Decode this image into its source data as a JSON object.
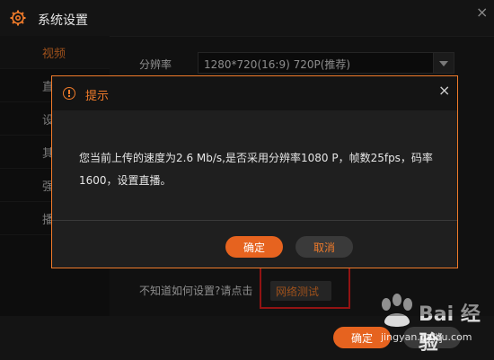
{
  "window": {
    "title": "系统设置"
  },
  "sidebar": {
    "items": [
      {
        "label": "视频",
        "active": true
      },
      {
        "label": "直",
        "active": false
      },
      {
        "label": "设",
        "active": false
      },
      {
        "label": "其",
        "active": false
      },
      {
        "label": "强",
        "active": false
      },
      {
        "label": "播",
        "active": false
      }
    ]
  },
  "settings": {
    "resolution_label": "分辨率",
    "resolution_value": "1280*720(16:9) 720P(推荐)",
    "help_text": "不知道如何设置?请点击",
    "network_test_label": "网络测试"
  },
  "footer": {
    "ok_label": "确定",
    "cancel_label": "取消"
  },
  "dialog": {
    "title": "提示",
    "close_glyph": "×",
    "message": "您当前上传的速度为2.6 Mb/s,是否采用分辨率1080 P，帧数25fps，码率1600，设置直播。",
    "ok_label": "确定",
    "cancel_label": "取消"
  },
  "watermark": {
    "brand": "Bai 经验",
    "domain": "jingyan.baidu.com"
  },
  "colors": {
    "accent": "#f07b2a",
    "highlight_box": "#e01e1e"
  }
}
